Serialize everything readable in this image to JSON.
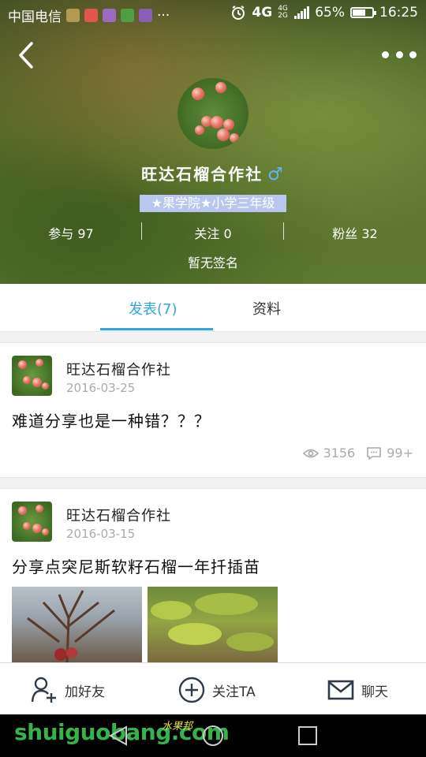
{
  "status_bar": {
    "carrier": "中国电信",
    "network": "4G",
    "network_small": "4G\n2G",
    "battery": "65%",
    "battery_level": 0.65,
    "time": "16:25",
    "more": "···"
  },
  "profile": {
    "name": "旺达石榴合作社",
    "gender_symbol": "♂",
    "badge": "★果学院★小学三年级",
    "stats": [
      {
        "label": "参与",
        "value": "97"
      },
      {
        "label": "关注",
        "value": "0"
      },
      {
        "label": "粉丝",
        "value": "32"
      }
    ],
    "signature": "暂无签名"
  },
  "tabs": [
    {
      "label": "发表(7)",
      "active": true
    },
    {
      "label": "资料",
      "active": false
    }
  ],
  "posts": [
    {
      "author": "旺达石榴合作社",
      "date": "2016-03-25",
      "text": "难道分享也是一种错？？？",
      "views": "3156",
      "comments": "99+"
    },
    {
      "author": "旺达石榴合作社",
      "date": "2016-03-15",
      "text": "分享点突尼斯软籽石榴一年扦插苗"
    }
  ],
  "actions": [
    {
      "label": "加好友",
      "icon": "add-friend-icon"
    },
    {
      "label": "关注TA",
      "icon": "plus-circle-icon"
    },
    {
      "label": "聊天",
      "icon": "mail-icon"
    }
  ],
  "watermark": {
    "text": "shuiguobang.com",
    "text_cn": "水果邦"
  },
  "colors": {
    "accent": "#2ea7e0",
    "gender": "#5fb6ff",
    "badge_bg": "#b8c6f0"
  }
}
